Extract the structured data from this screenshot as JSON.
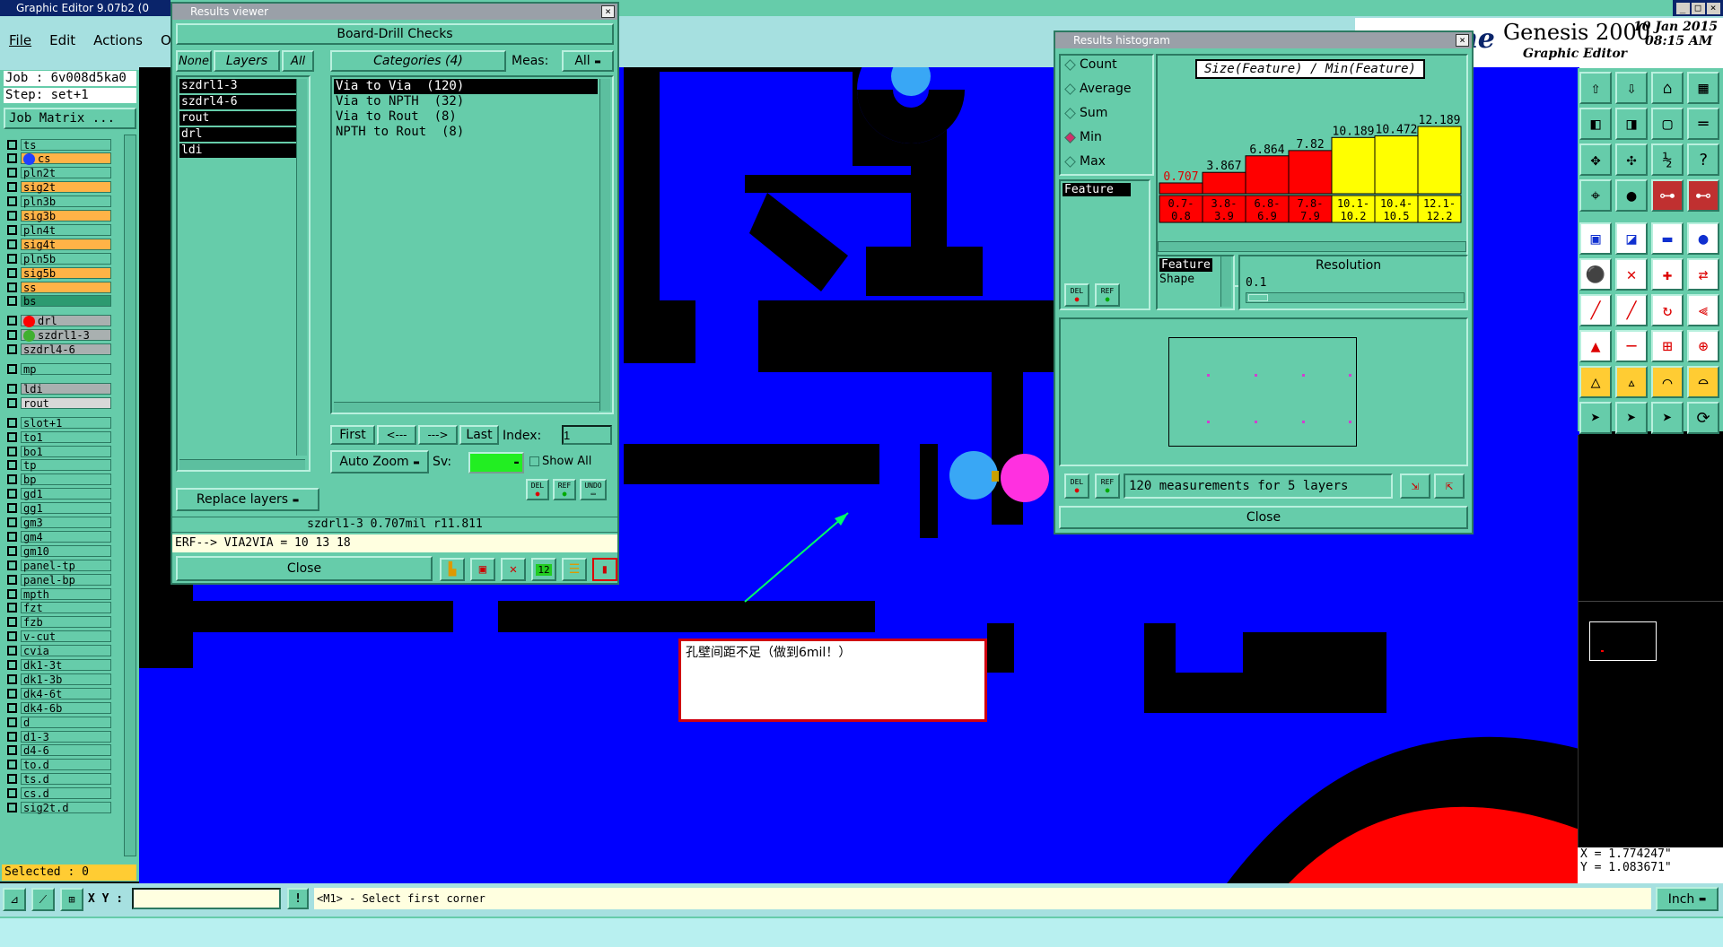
{
  "app": {
    "title": "Graphic Editor 9.07b2 (0",
    "brand": "Genesis 2000",
    "brand_sub": "Graphic Editor",
    "brand_partial": "ne",
    "date": "10 Jan 2015",
    "time": "08:15 AM"
  },
  "menu": [
    "File",
    "Edit",
    "Actions",
    "Opti"
  ],
  "job": {
    "job": "Job : 6v008d5ka0",
    "step": "Step: set+1",
    "matrix": "Job Matrix ..."
  },
  "layers": [
    {
      "name": "ts",
      "color": "#66ccaa"
    },
    {
      "name": "cs",
      "color": "#ffb347",
      "dot": "#2040ff"
    },
    {
      "name": "pln2t",
      "color": "#66ccaa"
    },
    {
      "name": "sig2t",
      "color": "#ffb347"
    },
    {
      "name": "pln3b",
      "color": "#66ccaa"
    },
    {
      "name": "sig3b",
      "color": "#ffb347"
    },
    {
      "name": "pln4t",
      "color": "#66ccaa"
    },
    {
      "name": "sig4t",
      "color": "#ffb347"
    },
    {
      "name": "pln5b",
      "color": "#66ccaa"
    },
    {
      "name": "sig5b",
      "color": "#ffb347"
    },
    {
      "name": "ss",
      "color": "#ffb347"
    },
    {
      "name": "bs",
      "color": "#2c9a70"
    },
    {
      "name": "drl",
      "color": "#a9b0b0",
      "dot": "#ff0000"
    },
    {
      "name": "szdrl1-3",
      "color": "#a9b0b0",
      "dot": "#40b030"
    },
    {
      "name": "szdrl4-6",
      "color": "#a9b0b0"
    },
    {
      "name": "mp",
      "color": "#66ccaa"
    },
    {
      "name": "ldi",
      "color": "#a9b0b0"
    },
    {
      "name": "rout",
      "color": "#d8d8d8"
    },
    {
      "name": "slot+1",
      "color": "#66ccaa"
    },
    {
      "name": "to1",
      "color": "#66ccaa"
    },
    {
      "name": "bo1",
      "color": "#66ccaa"
    },
    {
      "name": "tp",
      "color": "#66ccaa"
    },
    {
      "name": "bp",
      "color": "#66ccaa"
    },
    {
      "name": "gd1",
      "color": "#66ccaa"
    },
    {
      "name": "gg1",
      "color": "#66ccaa"
    },
    {
      "name": "gm3",
      "color": "#66ccaa"
    },
    {
      "name": "gm4",
      "color": "#66ccaa"
    },
    {
      "name": "gm10",
      "color": "#66ccaa"
    },
    {
      "name": "panel-tp",
      "color": "#66ccaa"
    },
    {
      "name": "panel-bp",
      "color": "#66ccaa"
    },
    {
      "name": "mpth",
      "color": "#66ccaa"
    },
    {
      "name": "fzt",
      "color": "#66ccaa"
    },
    {
      "name": "fzb",
      "color": "#66ccaa"
    },
    {
      "name": "v-cut",
      "color": "#66ccaa"
    },
    {
      "name": "cvia",
      "color": "#66ccaa"
    },
    {
      "name": "dk1-3t",
      "color": "#66ccaa"
    },
    {
      "name": "dk1-3b",
      "color": "#66ccaa"
    },
    {
      "name": "dk4-6t",
      "color": "#66ccaa"
    },
    {
      "name": "dk4-6b",
      "color": "#66ccaa"
    },
    {
      "name": "d",
      "color": "#66ccaa"
    },
    {
      "name": "d1-3",
      "color": "#66ccaa"
    },
    {
      "name": "d4-6",
      "color": "#66ccaa"
    },
    {
      "name": "to.d",
      "color": "#66ccaa"
    },
    {
      "name": "ts.d",
      "color": "#66ccaa"
    },
    {
      "name": "cs.d",
      "color": "#66ccaa"
    },
    {
      "name": "sig2t.d",
      "color": "#66ccaa"
    }
  ],
  "selected": "Selected : 0",
  "results_viewer": {
    "title": "Results viewer",
    "header": "Board-Drill Checks",
    "none": "None",
    "layers_label": "Layers",
    "all": "All",
    "layers": [
      "szdrl1-3",
      "szdrl4-6",
      "rout",
      "drl",
      "ldi"
    ],
    "categories_label": "Categories (4)",
    "meas_label": "Meas:",
    "meas_value": "All",
    "categories": [
      "Via to Via  (120)",
      "Via to NPTH  (32)",
      "Via to Rout  (8)",
      "NPTH to Rout  (8)"
    ],
    "first": "First",
    "prev": "<---",
    "next": "--->",
    "last": "Last",
    "index_label": "Index:",
    "index_value": "1",
    "auto_zoom": "Auto Zoom",
    "sv": "Sv:",
    "show_all": "Show All",
    "replace": "Replace layers",
    "del": "DEL",
    "ref": "REF",
    "undo": "UNDO",
    "info": "szdrl1-3 0.707mil  r11.811",
    "erf": "ERF--> VIA2VIA = 10 13 18",
    "close": "Close"
  },
  "histogram": {
    "title": "Results histogram",
    "options": [
      "Count",
      "Average",
      "Sum",
      "Min",
      "Max"
    ],
    "selected": "Min",
    "chart_title": "Size(Feature) / Min(Feature)",
    "list_item": "Feature",
    "feature_list": [
      "Feature",
      "Shape"
    ],
    "resolution_label": "Resolution",
    "resolution_value": "0.1",
    "status": "120 measurements for 5 layers",
    "close": "Close",
    "del": "DEL",
    "ref": "REF"
  },
  "chart_data": {
    "type": "bar",
    "title": "Size(Feature) / Min(Feature)",
    "categories": [
      "0.7-0.8",
      "3.8-3.9",
      "6.8-6.9",
      "7.8-7.9",
      "10.1-10.2",
      "10.4-10.5",
      "12.1-12.2"
    ],
    "values": [
      0.707,
      3.867,
      6.864,
      7.82,
      10.189,
      10.472,
      12.189
    ],
    "value_labels": [
      "0.707",
      "3.867",
      "6.864",
      "7.82",
      "10.189",
      "10.472",
      "12.189"
    ],
    "category_labels": [
      [
        "0.7-",
        "0.8"
      ],
      [
        "3.8-",
        "3.9"
      ],
      [
        "6.8-",
        "6.9"
      ],
      [
        "7.8-",
        "7.9"
      ],
      [
        "10.1-",
        "10.2"
      ],
      [
        "10.4-",
        "10.5"
      ],
      [
        "12.1-",
        "12.2"
      ]
    ],
    "colors": [
      "#ff0000",
      "#ff0000",
      "#ff0000",
      "#ff0000",
      "#ffff00",
      "#ffff00",
      "#ffff00"
    ],
    "ylim": [
      0,
      12.189
    ]
  },
  "annotation": "孔壁间距不足（做到6mil！）",
  "coords": {
    "x": "X = 1.774247\"",
    "y": "Y = 1.083671\""
  },
  "bottom": {
    "xy": "X Y :",
    "prompt": "<M1> - Select first corner",
    "units": "Inch"
  }
}
